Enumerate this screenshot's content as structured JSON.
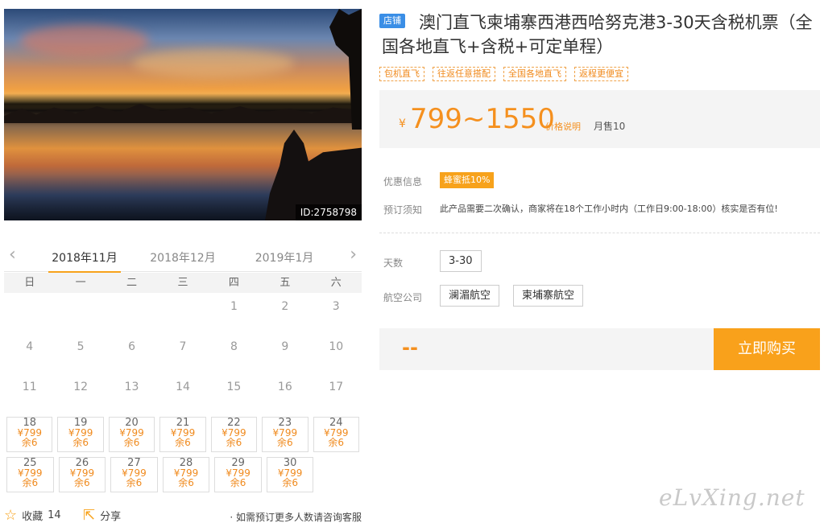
{
  "photo": {
    "id_label": "ID:2758798"
  },
  "calendar": {
    "prev_arrow": "‹",
    "next_arrow": "›",
    "months": [
      "2018年11月",
      "2018年12月",
      "2019年1月"
    ],
    "weekdays": [
      "日",
      "一",
      "二",
      "三",
      "四",
      "五",
      "六"
    ],
    "plain_days": [
      [
        "",
        "",
        "",
        "",
        "1",
        "2",
        "3"
      ],
      [
        "4",
        "5",
        "6",
        "7",
        "8",
        "9",
        "10"
      ],
      [
        "11",
        "12",
        "13",
        "14",
        "15",
        "16",
        "17"
      ]
    ],
    "available_days": [
      [
        {
          "day": "18",
          "price": "¥799",
          "remain": "余6"
        },
        {
          "day": "19",
          "price": "¥799",
          "remain": "余6"
        },
        {
          "day": "20",
          "price": "¥799",
          "remain": "余6"
        },
        {
          "day": "21",
          "price": "¥799",
          "remain": "余6"
        },
        {
          "day": "22",
          "price": "¥799",
          "remain": "余6"
        },
        {
          "day": "23",
          "price": "¥799",
          "remain": "余6"
        },
        {
          "day": "24",
          "price": "¥799",
          "remain": "余6"
        }
      ],
      [
        {
          "day": "25",
          "price": "¥799",
          "remain": "余6"
        },
        {
          "day": "26",
          "price": "¥799",
          "remain": "余6"
        },
        {
          "day": "27",
          "price": "¥799",
          "remain": "余6"
        },
        {
          "day": "28",
          "price": "¥799",
          "remain": "余6"
        },
        {
          "day": "29",
          "price": "¥799",
          "remain": "余6"
        },
        {
          "day": "30",
          "price": "¥799",
          "remain": "余6"
        }
      ]
    ]
  },
  "bottom": {
    "favorite_label": "收藏",
    "favorite_count": "14",
    "share_label": "分享",
    "note": "· 如需预订更多人数请咨询客服"
  },
  "product": {
    "shop_badge": "店铺",
    "title": "澳门直飞柬埔寨西港西哈努克港3-30天含税机票（全国各地直飞+含税+可定单程）",
    "tags": [
      "包机直飞",
      "往返任意搭配",
      "全国各地直飞",
      "返程更便宜"
    ],
    "price_currency": "¥",
    "price_range": "799~1550",
    "price_explain": "价格说明",
    "monthly_sales": "月售10",
    "promo_label": "优惠信息",
    "promo_badge": "蜂蜜抵10%",
    "notice_label": "预订须知",
    "notice_text": "此产品需要二次确认，商家将在18个工作小时内（工作日9:00-18:00）核实是否有位!",
    "days_label": "天数",
    "days_option": "3-30",
    "airline_label": "航空公司",
    "airline_options": [
      "澜湄航空",
      "柬埔寨航空"
    ],
    "total_placeholder": "--",
    "buy_button": "立即购买"
  },
  "watermark": "eLvXing.net",
  "colors": {
    "accent": "#f9a11b",
    "price": "#f5901e",
    "badge_blue": "#3a8ee6"
  }
}
